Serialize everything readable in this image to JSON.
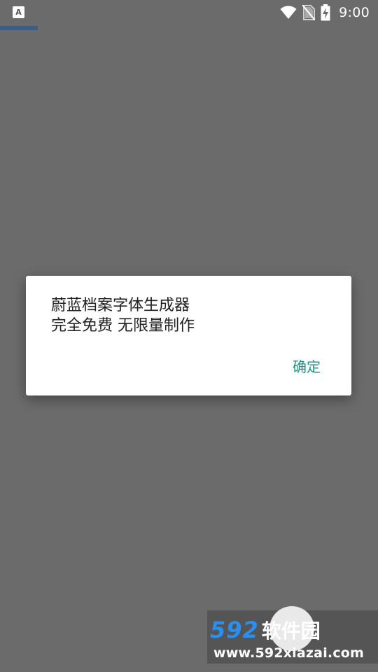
{
  "status_bar": {
    "app_icon_letter": "A",
    "time": "9:00",
    "icons": [
      "wifi-icon",
      "no-sim-icon",
      "battery-charging-icon"
    ]
  },
  "dialog": {
    "lines": [
      "蔚蓝档案字体生成器",
      "完全免费 无限量制作"
    ],
    "confirm_label": "确定",
    "button_color": "#1f9080"
  },
  "watermark": {
    "number": "592",
    "brand": "软件园",
    "url": "www.592xiazai.com"
  },
  "colors": {
    "scrim": "#6b6b6b",
    "accent_line": "#3a5e86"
  }
}
